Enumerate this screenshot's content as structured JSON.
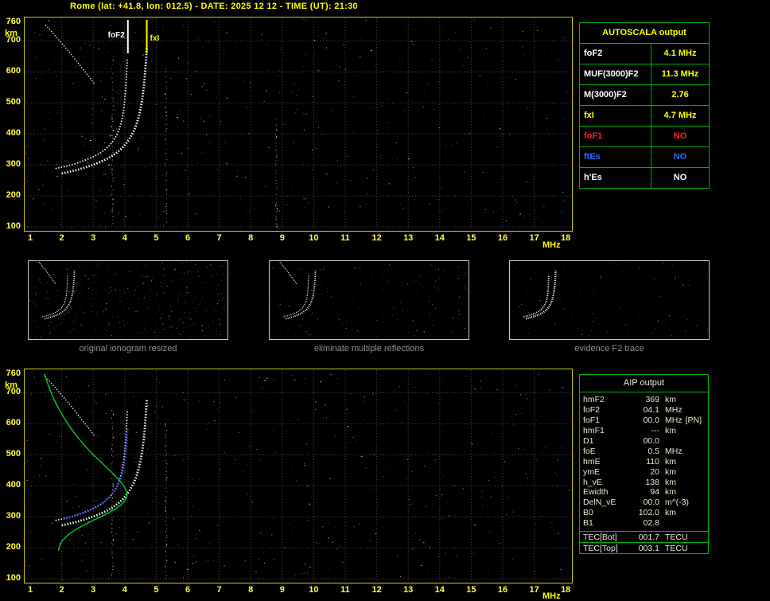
{
  "header": {
    "title": "Rome (lat: +41.8, lon: 012.5) - DATE: 2025 12 12 - TIME (UT): 21:30"
  },
  "autoscala": {
    "title": "AUTOSCALA output",
    "rows": [
      {
        "label": "foF2",
        "value": "4.1 MHz",
        "label_color": "#ffffff",
        "value_color": "#ffff00"
      },
      {
        "label": "MUF(3000)F2",
        "value": "11.3 MHz",
        "label_color": "#ffffff",
        "value_color": "#ffff00"
      },
      {
        "label": "M(3000)F2",
        "value": "2.76",
        "label_color": "#ffffff",
        "value_color": "#ffff00"
      },
      {
        "label": "fxI",
        "value": "4.7 MHz",
        "label_color": "#ffff00",
        "value_color": "#ffff00"
      },
      {
        "label": "foF1",
        "value": "NO",
        "label_color": "#ff2020",
        "value_color": "#ff2020"
      },
      {
        "label": "ftEs",
        "value": "NO",
        "label_color": "#2e6bff",
        "value_color": "#2e6bff"
      },
      {
        "label": "h'Es",
        "value": "NO",
        "label_color": "#ffffff",
        "value_color": "#ffffff"
      }
    ]
  },
  "aip": {
    "title": "AIP output",
    "rows": [
      {
        "name": "hmF2",
        "value": "369",
        "unit": "km",
        "extra": ""
      },
      {
        "name": "foF2",
        "value": "04.1",
        "unit": "MHz",
        "extra": ""
      },
      {
        "name": "foF1",
        "value": "00.0",
        "unit": "MHz",
        "extra": "[PN]"
      },
      {
        "name": "hmF1",
        "value": "---",
        "unit": "km",
        "extra": ""
      },
      {
        "name": "D1",
        "value": "00.0",
        "unit": "",
        "extra": ""
      },
      {
        "name": "foE",
        "value": "0.5",
        "unit": "MHz",
        "extra": ""
      },
      {
        "name": "hmE",
        "value": "110",
        "unit": "km",
        "extra": ""
      },
      {
        "name": "ymE",
        "value": "20",
        "unit": "km",
        "extra": ""
      },
      {
        "name": "h_vE",
        "value": "138",
        "unit": "km",
        "extra": ""
      },
      {
        "name": "Ewidth",
        "value": "94",
        "unit": "km",
        "extra": ""
      },
      {
        "name": "DelN_vE",
        "value": "00.0",
        "unit": "m^(-3)",
        "extra": ""
      },
      {
        "name": "B0",
        "value": "102.0",
        "unit": "km",
        "extra": ""
      },
      {
        "name": "B1",
        "value": "02.8",
        "unit": "",
        "extra": ""
      }
    ],
    "tec_rows": [
      {
        "name": "TEC[Bot]",
        "value": "001.7",
        "unit": "TECU"
      },
      {
        "name": "TEC[Top]",
        "value": "003.1",
        "unit": "TECU"
      }
    ]
  },
  "thumbnails": [
    {
      "caption": "original ionogram resized"
    },
    {
      "caption": "eliminate multiple reflections"
    },
    {
      "caption": "evidence F2 trace"
    }
  ],
  "colors": {
    "accent_yellow": "#ffff00",
    "table_border_green": "#00b400",
    "profile_green": "#00cc33",
    "fitted_blue": "#3344ff",
    "foF1_red": "#ff2020",
    "ftEs_blue": "#2e6bff"
  },
  "chart_data": [
    {
      "type": "scatter",
      "title": "recorded ionogram (Rome 2025-12-12 21:30 UT)",
      "xlabel": "MHz",
      "ylabel": "km",
      "xlim": [
        1,
        18
      ],
      "ylim": [
        90,
        775
      ],
      "grid": true,
      "xticks": [
        1,
        2,
        3,
        4,
        5,
        6,
        7,
        8,
        9,
        10,
        11,
        12,
        13,
        14,
        15,
        16,
        17,
        18
      ],
      "yticks": [
        760,
        700,
        600,
        500,
        400,
        300,
        200,
        100
      ],
      "markers": [
        {
          "label": "foF2",
          "mhz": 4.1,
          "color": "#ffffff"
        },
        {
          "label": "fxI",
          "mhz": 4.7,
          "color": "#ffff00"
        }
      ],
      "interference_columns_mhz": [
        3.6,
        5.3,
        8.8
      ],
      "series": [
        {
          "name": "F2 O-mode trace",
          "color": "#ffffff",
          "width": 1.8,
          "dash": "dot",
          "x": [
            1.8,
            2.1,
            2.4,
            2.7,
            3.0,
            3.25,
            3.45,
            3.62,
            3.76,
            3.87,
            3.95,
            4.01,
            4.05,
            4.08
          ],
          "y": [
            288,
            295,
            303,
            313,
            326,
            340,
            356,
            375,
            398,
            428,
            465,
            515,
            575,
            645
          ]
        },
        {
          "name": "F2 X-mode trace",
          "color": "#ffffff",
          "width": 2.8,
          "dash": "dot",
          "x": [
            2.0,
            2.35,
            2.7,
            3.05,
            3.4,
            3.7,
            3.95,
            4.15,
            4.32,
            4.45,
            4.55,
            4.62,
            4.67,
            4.7
          ],
          "y": [
            272,
            280,
            290,
            302,
            317,
            335,
            357,
            383,
            415,
            455,
            505,
            565,
            625,
            680
          ]
        },
        {
          "name": "multiple reflection streak",
          "color": "#e8e8e8",
          "width": 1.4,
          "dash": "dot",
          "x": [
            1.48,
            1.85,
            2.25,
            2.65,
            3.05
          ],
          "y": [
            752,
            710,
            663,
            612,
            560
          ]
        }
      ]
    },
    {
      "type": "scatter",
      "title": "ionogram with AIP inversion (restored trace and electron density profile)",
      "xlabel": "MHz",
      "ylabel": "km",
      "xlim": [
        1,
        18
      ],
      "ylim": [
        90,
        775
      ],
      "grid": true,
      "xticks": [
        1,
        2,
        3,
        4,
        5,
        6,
        7,
        8,
        9,
        10,
        11,
        12,
        13,
        14,
        15,
        16,
        17,
        18
      ],
      "yticks": [
        760,
        700,
        600,
        500,
        400,
        300,
        200,
        100
      ],
      "markers": [],
      "interference_columns_mhz": [
        3.6,
        5.3
      ],
      "series": [
        {
          "name": "F2 O-mode trace",
          "color": "#ffffff",
          "width": 1.8,
          "dash": "dot",
          "x": [
            1.8,
            2.1,
            2.4,
            2.7,
            3.0,
            3.25,
            3.45,
            3.62,
            3.76,
            3.87,
            3.95,
            4.01,
            4.05,
            4.08
          ],
          "y": [
            288,
            295,
            303,
            313,
            326,
            340,
            356,
            375,
            398,
            428,
            465,
            515,
            575,
            645
          ]
        },
        {
          "name": "F2 X-mode trace",
          "color": "#ffffff",
          "width": 2.8,
          "dash": "dot",
          "x": [
            2.0,
            2.35,
            2.7,
            3.05,
            3.4,
            3.7,
            3.95,
            4.15,
            4.32,
            4.45,
            4.55,
            4.62,
            4.67,
            4.7
          ],
          "y": [
            272,
            280,
            290,
            302,
            317,
            335,
            357,
            383,
            415,
            455,
            505,
            565,
            625,
            680
          ]
        },
        {
          "name": "multiple reflection streak",
          "color": "#e8e8e8",
          "width": 1.4,
          "dash": "dot",
          "x": [
            1.48,
            1.85,
            2.25,
            2.65,
            3.05
          ],
          "y": [
            752,
            710,
            663,
            612,
            560
          ]
        },
        {
          "name": "restored trace fit",
          "color": "#3344ff",
          "width": 2.6,
          "dash": "dot",
          "x": [
            2.05,
            2.4,
            2.75,
            3.1,
            3.4,
            3.65,
            3.85,
            3.98,
            4.05,
            4.09
          ],
          "y": [
            292,
            302,
            315,
            332,
            352,
            378,
            412,
            460,
            520,
            585
          ]
        },
        {
          "name": "electron density profile N(h)",
          "color": "#00cc33",
          "width": 1.5,
          "dash": "solid",
          "x": [
            1.45,
            1.6,
            1.8,
            2.05,
            2.35,
            2.7,
            3.1,
            3.5,
            3.82,
            4.02,
            4.1,
            3.95,
            3.6,
            3.15,
            2.7,
            2.3,
            2.05,
            1.93,
            1.9
          ],
          "y": [
            760,
            715,
            668,
            622,
            576,
            532,
            490,
            452,
            420,
            392,
            369,
            342,
            318,
            296,
            273,
            250,
            228,
            208,
            190
          ]
        }
      ]
    }
  ]
}
